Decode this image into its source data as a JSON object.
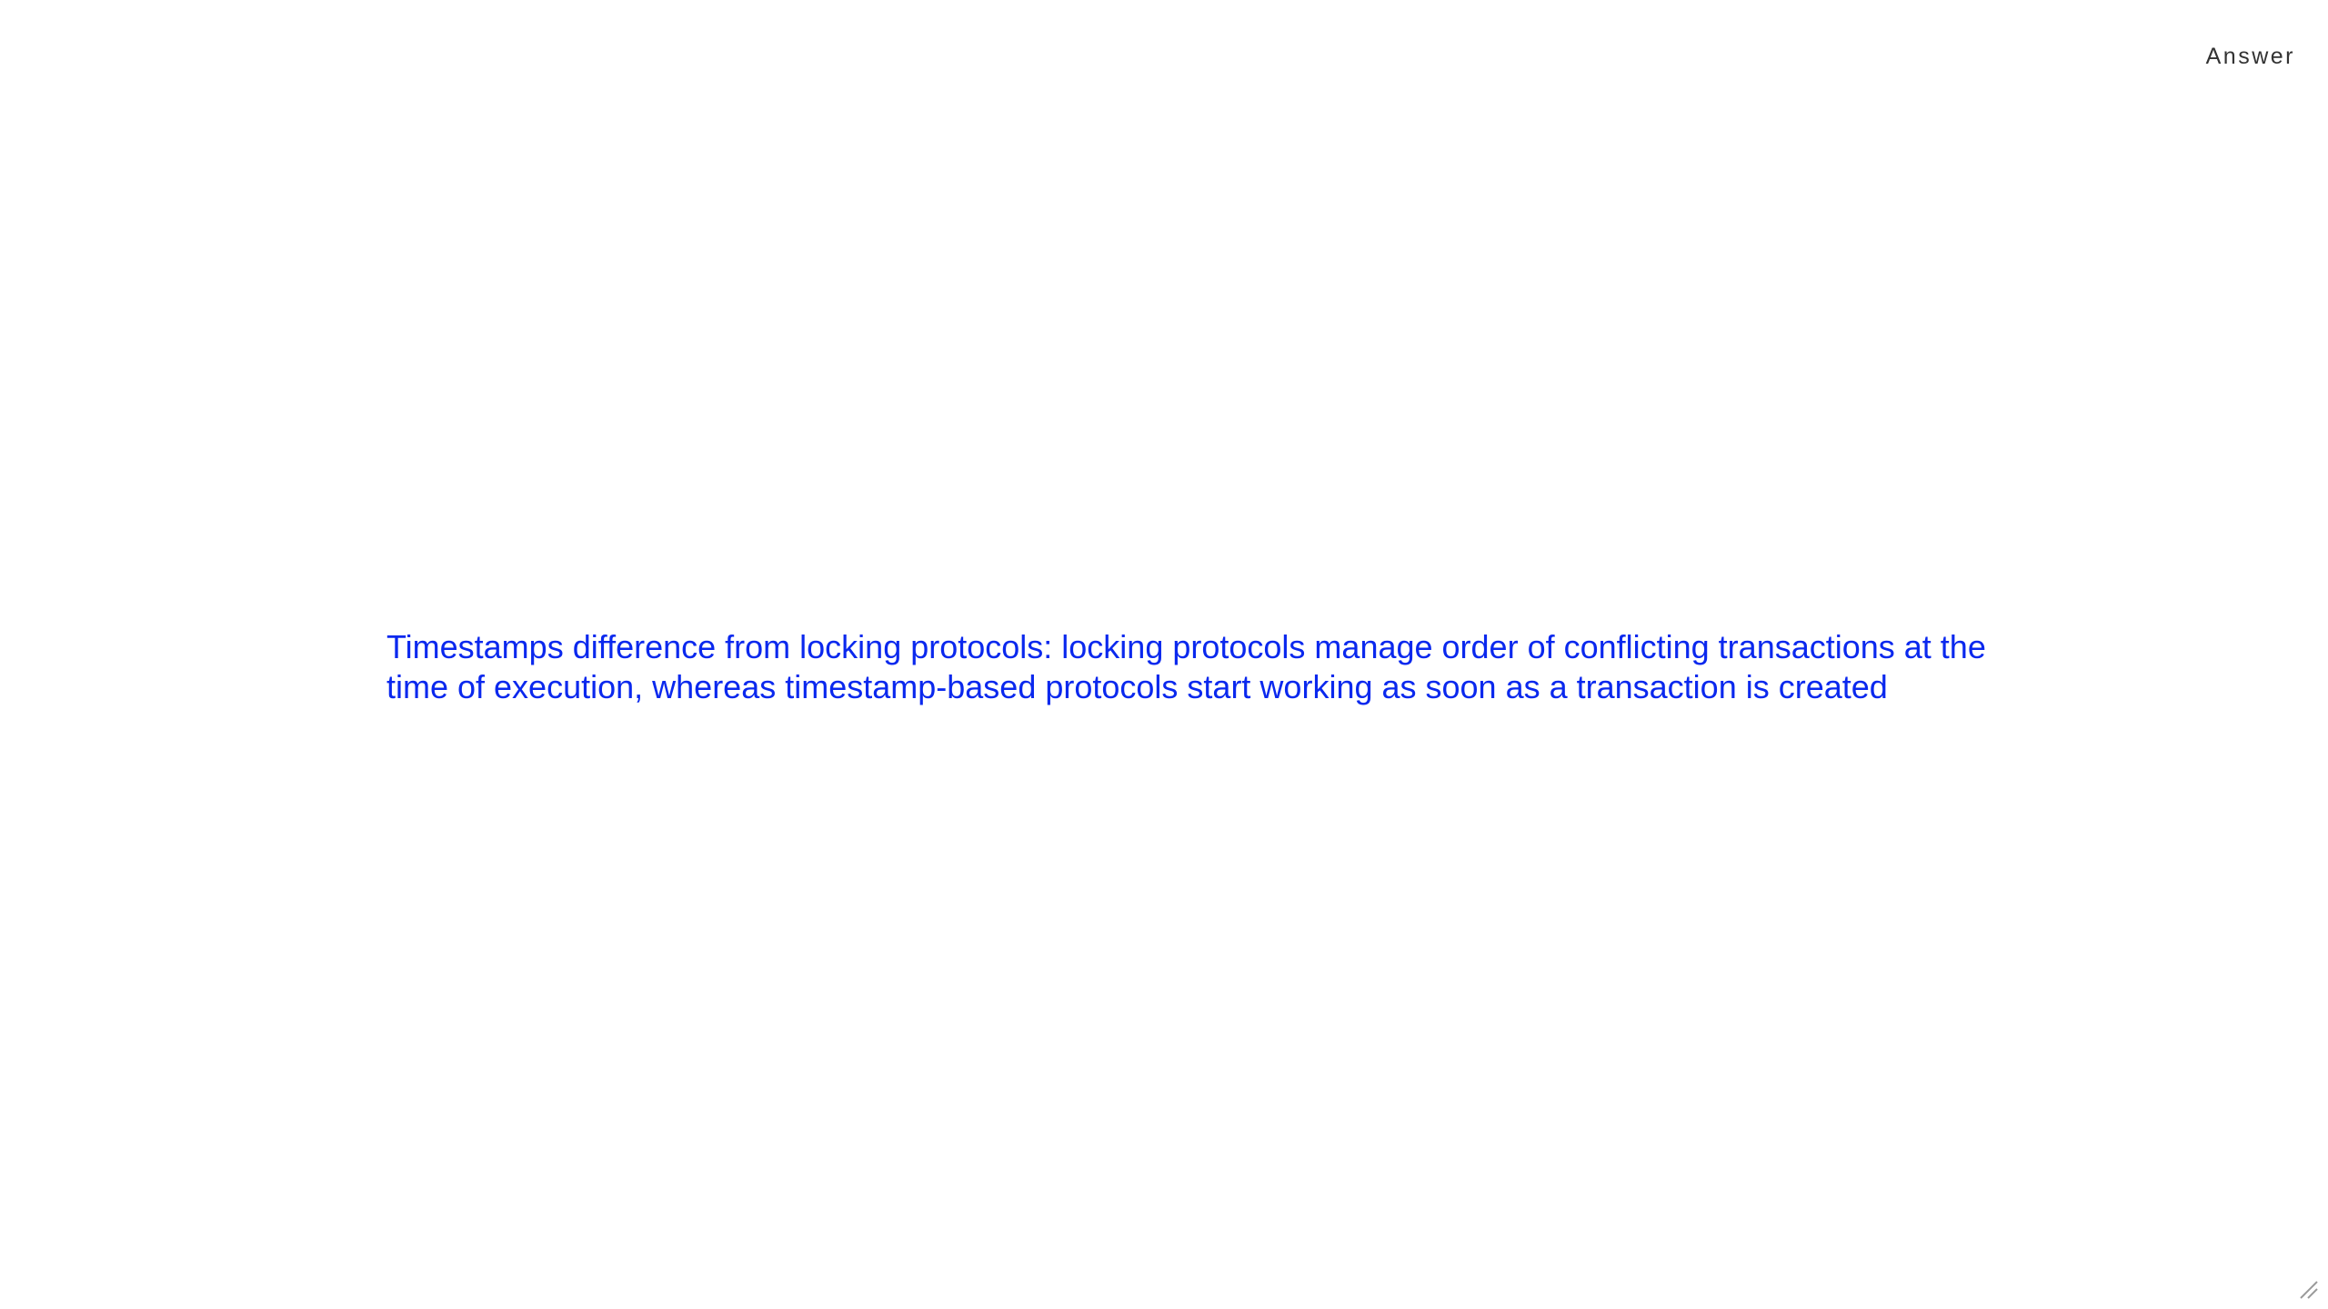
{
  "header": {
    "label": "Answer"
  },
  "card": {
    "answer_lines": [
      "Timestamps difference from locking protocols: locking protocols manage order of conflicting transactions at the",
      "time of execution, whereas timestamp-based protocols start working as soon as a transaction is created"
    ],
    "text_color": "#0a28ee"
  },
  "icons": {
    "resize_handle": "resize-handle-icon"
  }
}
